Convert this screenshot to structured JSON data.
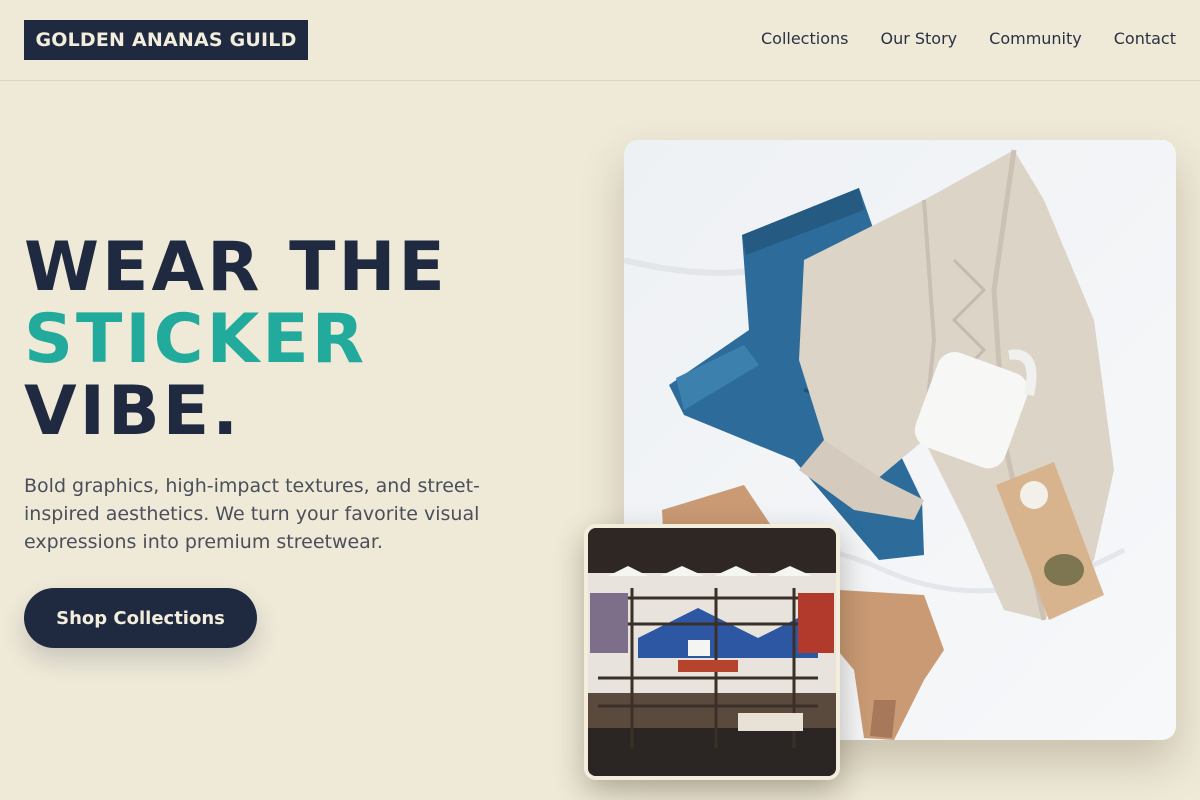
{
  "header": {
    "logo": "GOLDEN ANANAS GUILD",
    "nav": [
      "Collections",
      "Our Story",
      "Community",
      "Contact"
    ]
  },
  "hero": {
    "headline_line1": "WEAR THE",
    "headline_line2": "STICKER",
    "headline_line3": "VIBE.",
    "description": "Bold graphics, high-impact textures, and street-inspired aesthetics. We turn your favorite visual expressions into premium streetwear.",
    "cta_label": "Shop Collections"
  },
  "images": {
    "main": "flat-lay of jeans, knit cardigan, mug and boots",
    "inset": "clothing store interior with pendant lamps and shelves"
  },
  "colors": {
    "background": "#efe9d8",
    "primary_dark": "#1f2a40",
    "accent_teal": "#22aa9c"
  }
}
